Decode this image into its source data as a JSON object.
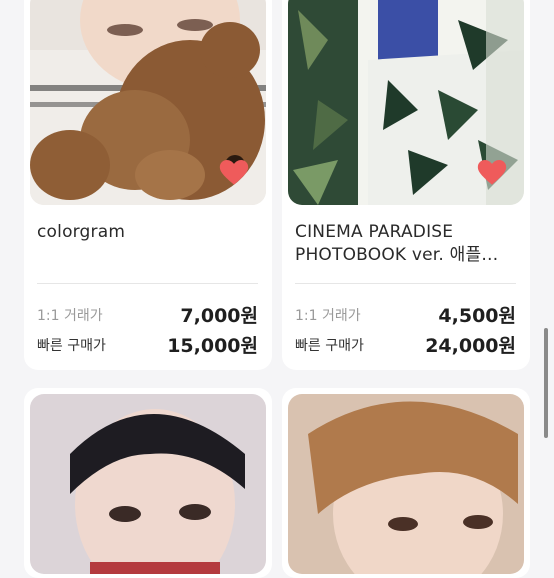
{
  "products": [
    {
      "title_lines": [
        "colorgram"
      ],
      "price_label": "1:1 거래가",
      "price": "7,000원",
      "buy_label": "빠른 구매가",
      "buy_price": "15,000원",
      "liked": true
    },
    {
      "title_lines": [
        "CINEMA PARADISE",
        "PHOTOBOOK ver. 애플…"
      ],
      "price_label": "1:1 거래가",
      "price": "4,500원",
      "buy_label": "빠른 구매가",
      "buy_price": "24,000원",
      "liked": true
    },
    {
      "title_lines": [],
      "liked": false
    },
    {
      "title_lines": [],
      "liked": false
    }
  ],
  "colors": {
    "heart": "#ef5b5b",
    "background": "#f5f5f7",
    "card": "#ffffff"
  },
  "icons": {
    "like": "heart-icon"
  }
}
